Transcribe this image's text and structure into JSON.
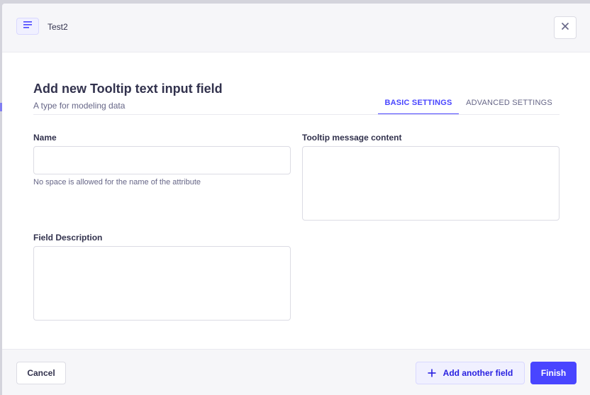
{
  "header": {
    "icon": "text-align-left-icon",
    "title": "Test2",
    "close_icon": "close-icon"
  },
  "form": {
    "title": "Add new Tooltip text input field",
    "subtitle": "A type for modeling data"
  },
  "tabs": [
    {
      "label": "BASIC SETTINGS",
      "active": true
    },
    {
      "label": "ADVANCED SETTINGS",
      "active": false
    }
  ],
  "fields": {
    "name": {
      "label": "Name",
      "value": "",
      "hint": "No space is allowed for the name of the attribute"
    },
    "tooltip_message": {
      "label": "Tooltip message content",
      "value": ""
    },
    "description": {
      "label": "Field Description",
      "value": ""
    }
  },
  "footer": {
    "cancel_label": "Cancel",
    "add_field_label": "Add another field",
    "add_field_icon": "plus-icon",
    "finish_label": "Finish"
  },
  "colors": {
    "primary": "#4945ff",
    "primary_light": "#f0f0ff",
    "text": "#32324d",
    "muted": "#666687"
  }
}
